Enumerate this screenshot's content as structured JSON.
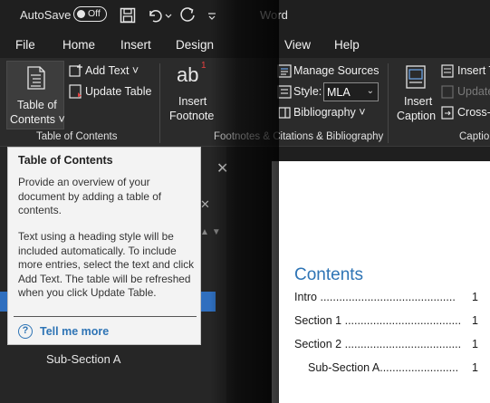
{
  "titlebar": {
    "autosave_label": "AutoSave",
    "autosave_state": "Off",
    "doc_title": "Word"
  },
  "menu": {
    "items": [
      "File",
      "Home",
      "Insert",
      "Design",
      "View",
      "Help"
    ]
  },
  "ribbon": {
    "toc": {
      "label_line1": "Table of",
      "label_line2": "Contents ˅",
      "add_text": "Add Text ˅",
      "update_table": "Update Table",
      "group_label": "Table of Contents"
    },
    "footnotes": {
      "icon_text": "ab",
      "icon_super": "1",
      "insert_line1": "Insert",
      "insert_line2": "Footnote",
      "group_label": "Footnotes & Citations & Bibliography"
    },
    "citations": {
      "manage_sources": "Manage Sources",
      "style_label": "Style:",
      "style_value": "MLA",
      "bibliography": "Bibliography ˅"
    },
    "captions": {
      "insert_line1": "Insert",
      "insert_line2": "Caption",
      "insert_table": "Insert T",
      "update": "Update",
      "cross_ref": "Cross-r",
      "group_label": "Captio"
    }
  },
  "tooltip": {
    "title": "Table of Contents",
    "p1": "Provide an overview of your document by adding a table of contents.",
    "p2": "Text using a heading style will be included automatically. To include more entries, select the text and click Add Text. The table will be refreshed when you click Update Table.",
    "help_icon": "?",
    "link": "Tell me more"
  },
  "nav_pane": {
    "close": "✕",
    "clear": "✕",
    "sub_section": "Sub-Section A"
  },
  "document": {
    "heading": "Contents",
    "entries": [
      {
        "text": "Intro ...........................................",
        "page": "1"
      },
      {
        "text": "Section 1 .....................................",
        "page": "1"
      },
      {
        "text": "Section 2 .....................................",
        "page": "1"
      },
      {
        "text": "Sub-Section A.........................",
        "page": "1"
      }
    ]
  },
  "colors": {
    "accent_blue": "#2e74b5",
    "selection_blue": "#2f6fbf",
    "ribbon_bg": "#2b2b2b",
    "titlebar_bg": "#1f1f1f"
  }
}
